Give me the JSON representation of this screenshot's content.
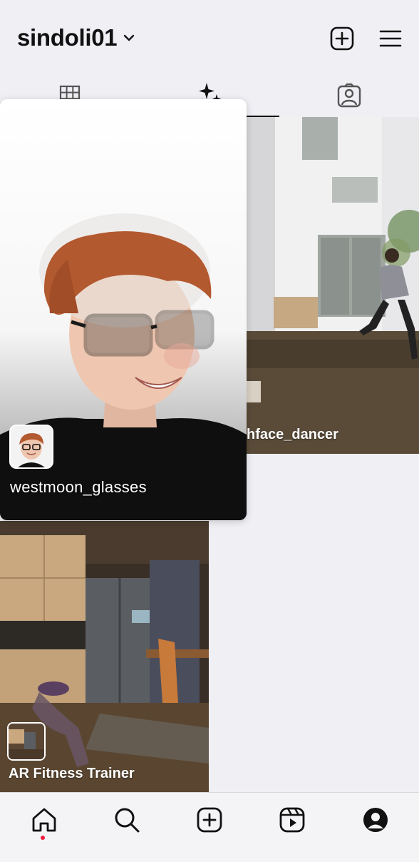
{
  "header": {
    "username": "sindoli01",
    "icons": {
      "chevron": "chevron-down-icon",
      "create": "plus-square-icon",
      "menu": "hamburger-menu-icon"
    }
  },
  "tabs": [
    {
      "icon": "grid-icon",
      "active": false
    },
    {
      "icon": "sparkles-effects-icon",
      "active": true
    },
    {
      "icon": "tagged-person-icon",
      "active": false
    }
  ],
  "effects": [
    {
      "caption": "westmoon_glasses",
      "elevated": true
    },
    {
      "caption": "hface_dancer",
      "elevated": false
    },
    {
      "caption": "AR Fitness Trainer",
      "elevated": false
    }
  ],
  "bottom_nav": {
    "items": [
      "home-icon",
      "search-icon",
      "create-icon",
      "reels-icon",
      "profile-icon"
    ],
    "active": "home-icon",
    "notification_dot_color": "#ed1c40"
  }
}
